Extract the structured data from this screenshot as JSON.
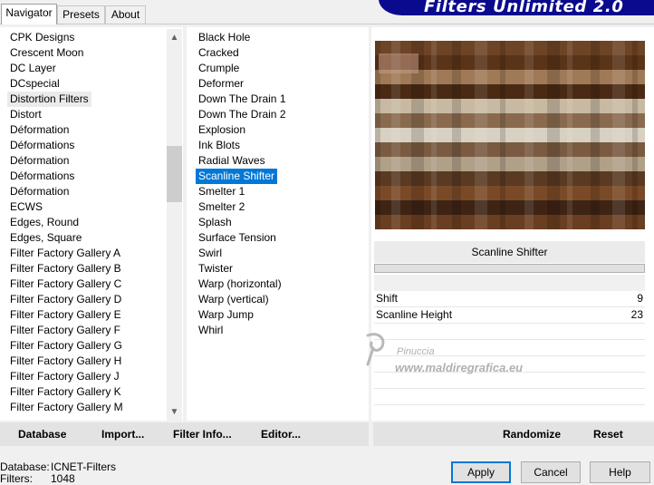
{
  "app": {
    "banner": "Filters Unlimited 2.0"
  },
  "tabs": [
    "Navigator",
    "Presets",
    "About"
  ],
  "categories": [
    "CPK Designs",
    "Crescent Moon",
    "DC Layer",
    "DCspecial",
    "Distortion Filters",
    "Distort",
    "Déformation",
    "Déformations",
    "Déformation",
    "Déformations",
    "Déformation",
    "ECWS",
    "Edges, Round",
    "Edges, Square",
    "Filter Factory Gallery A",
    "Filter Factory Gallery B",
    "Filter Factory Gallery C",
    "Filter Factory Gallery D",
    "Filter Factory Gallery E",
    "Filter Factory Gallery F",
    "Filter Factory Gallery G",
    "Filter Factory Gallery H",
    "Filter Factory Gallery J",
    "Filter Factory Gallery K",
    "Filter Factory Gallery M"
  ],
  "categories_highlighted": "Distortion Filters",
  "filters": [
    "Black Hole",
    "Cracked",
    "Crumple",
    "Deformer",
    "Down The Drain 1",
    "Down The Drain 2",
    "Explosion",
    "Ink Blots",
    "Radial Waves",
    "Scanline Shifter",
    "Smelter 1",
    "Smelter 2",
    "Splash",
    "Surface Tension",
    "Swirl",
    "Twister",
    "Warp (horizontal)",
    "Warp (vertical)",
    "Warp Jump",
    "Whirl"
  ],
  "filters_selected": "Scanline Shifter",
  "preview": {
    "filter_name": "Scanline Shifter"
  },
  "params": [
    {
      "label": "Shift",
      "value": "9"
    },
    {
      "label": "Scanline Height",
      "value": "23"
    }
  ],
  "watermark": {
    "line1": "Pinuccia",
    "line2": "www.maldiregrafica.eu"
  },
  "left_buttons": [
    "Database",
    "Import...",
    "Filter Info...",
    "Editor..."
  ],
  "right_buttons": [
    "Randomize",
    "Reset"
  ],
  "status": {
    "database_label": "Database:",
    "database_value": "ICNET-Filters",
    "filters_label": "Filters:",
    "filters_value": "1048"
  },
  "dialog_buttons": {
    "apply": "Apply",
    "cancel": "Cancel",
    "help": "Help"
  },
  "colors": {
    "selection": "#0078d7",
    "banner": "#0a0a8e",
    "preview_dark": "#5a3418",
    "preview_mid": "#8a5a32",
    "preview_light": "#c8baa2"
  }
}
